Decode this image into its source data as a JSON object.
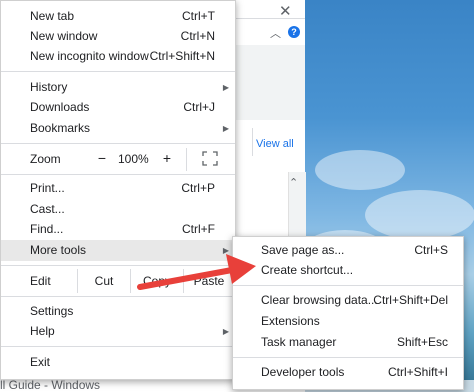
{
  "background": {
    "view_all": "View all",
    "bottom_text": "ll Guide - Windows"
  },
  "main_menu": {
    "new_tab": {
      "label": "New tab",
      "shortcut": "Ctrl+T"
    },
    "new_window": {
      "label": "New window",
      "shortcut": "Ctrl+N"
    },
    "new_incognito": {
      "label": "New incognito window",
      "shortcut": "Ctrl+Shift+N"
    },
    "history": {
      "label": "History"
    },
    "downloads": {
      "label": "Downloads",
      "shortcut": "Ctrl+J"
    },
    "bookmarks": {
      "label": "Bookmarks"
    },
    "zoom": {
      "label": "Zoom",
      "minus": "−",
      "value": "100%",
      "plus": "+"
    },
    "print": {
      "label": "Print...",
      "shortcut": "Ctrl+P"
    },
    "cast": {
      "label": "Cast..."
    },
    "find": {
      "label": "Find...",
      "shortcut": "Ctrl+F"
    },
    "more_tools": {
      "label": "More tools"
    },
    "edit": {
      "label": "Edit",
      "cut": "Cut",
      "copy": "Copy",
      "paste": "Paste"
    },
    "settings": {
      "label": "Settings"
    },
    "help": {
      "label": "Help"
    },
    "exit": {
      "label": "Exit"
    }
  },
  "more_tools_submenu": {
    "save_page": {
      "label": "Save page as...",
      "shortcut": "Ctrl+S"
    },
    "create_shortcut": {
      "label": "Create shortcut..."
    },
    "clear_browsing": {
      "label": "Clear browsing data...",
      "shortcut": "Ctrl+Shift+Del"
    },
    "extensions": {
      "label": "Extensions"
    },
    "task_manager": {
      "label": "Task manager",
      "shortcut": "Shift+Esc"
    },
    "developer_tools": {
      "label": "Developer tools",
      "shortcut": "Ctrl+Shift+I"
    }
  },
  "colors": {
    "annotation_arrow": "#e8403a",
    "hover": "#e8e8e8",
    "link": "#1a73e8"
  }
}
